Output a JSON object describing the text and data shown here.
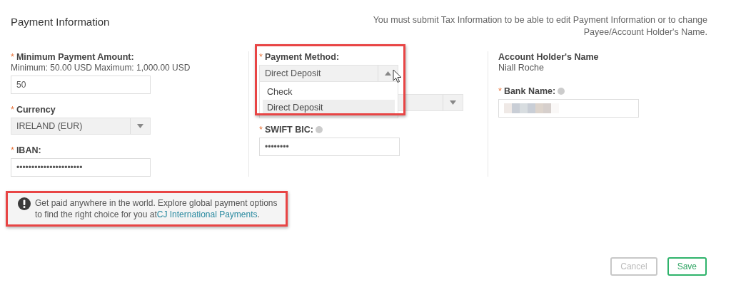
{
  "header": {
    "title": "Payment Information",
    "notice": "You must submit Tax Information to be able to edit Payment Information or to change Payee/Account Holder's Name."
  },
  "min_amount": {
    "label": "Minimum Payment Amount:",
    "required_mark": "*",
    "hint": "Minimum: 50.00 USD Maximum: 1,000.00 USD",
    "value": "50"
  },
  "currency": {
    "label": "Currency",
    "required_mark": "*",
    "value": "IRELAND (EUR)"
  },
  "iban": {
    "label": "IBAN:",
    "required_mark": "*",
    "value": "••••••••••••••••••••••"
  },
  "payment_method": {
    "label": "Payment Method:",
    "required_mark": "*",
    "value": "Direct Deposit",
    "expanded": true,
    "highlighted": true,
    "options": [
      {
        "label": "Check",
        "selected": false
      },
      {
        "label": "Direct Deposit",
        "selected": true
      }
    ]
  },
  "swift": {
    "label": "SWIFT BIC:",
    "required_mark": "*",
    "help": true,
    "value": "••••••••"
  },
  "account_holder": {
    "label": "Account Holder's Name",
    "value": "Niall Roche"
  },
  "bank_name": {
    "label": "Bank Name:",
    "required_mark": "*",
    "help": true
  },
  "info": {
    "text": "Get paid anywhere in the world. Explore global payment options to find the right choice for you at",
    "link": "CJ International Payments",
    "after": ".",
    "highlighted": true
  },
  "buttons": [
    {
      "label": "Cancel",
      "kind": "secondary",
      "disabled": true
    },
    {
      "label": "Save",
      "kind": "primary",
      "disabled": false
    }
  ]
}
